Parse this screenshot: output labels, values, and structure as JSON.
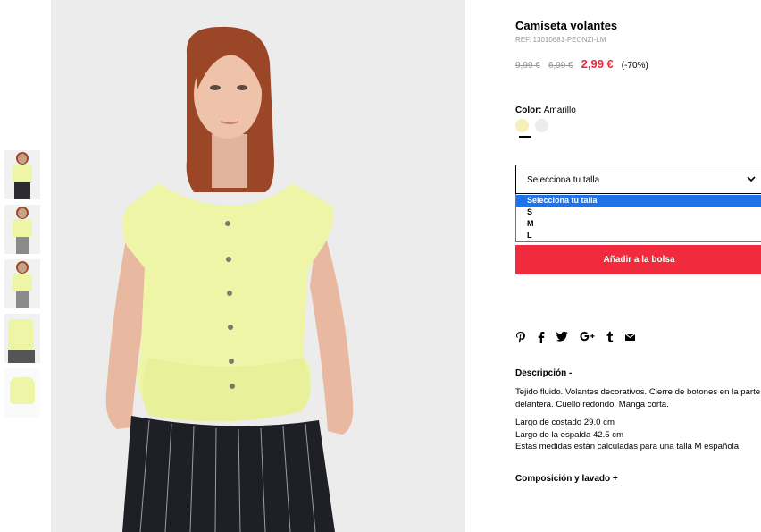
{
  "product": {
    "title": "Camiseta volantes",
    "ref": "REF. 13010681-PEONZI-LM",
    "price_old_1": "9,99 €",
    "price_old_2": "6,99 €",
    "price_new": "2,99 €",
    "discount": "(-70%)"
  },
  "color": {
    "label": "Color:",
    "value": "Amarillo",
    "swatches": [
      "#f6efb9",
      "#ececec"
    ]
  },
  "size": {
    "selected": "Selecciona tu talla",
    "options": [
      "Selecciona tu talla",
      "S",
      "M",
      "L"
    ]
  },
  "add_to_bag": "Añadir a la bolsa",
  "social_icons": [
    "pinterest-icon",
    "facebook-icon",
    "twitter-icon",
    "google-plus-icon",
    "tumblr-icon",
    "email-icon"
  ],
  "description": {
    "heading": "Descripción  -",
    "text": "Tejido fluido. Volantes decorativos. Cierre de botones en la parte delantera. Cuello redondo. Manga corta.",
    "measures": [
      "Largo de costado 29.0 cm",
      "Largo de la espalda 42.5 cm",
      "Estas medidas están calculadas para una talla M española."
    ]
  },
  "composition": {
    "heading": "Composición y lavado  +"
  },
  "colors": {
    "accent_red": "#f12a3d",
    "price_red": "#e62a3d",
    "highlight_blue": "#1e73e8"
  }
}
